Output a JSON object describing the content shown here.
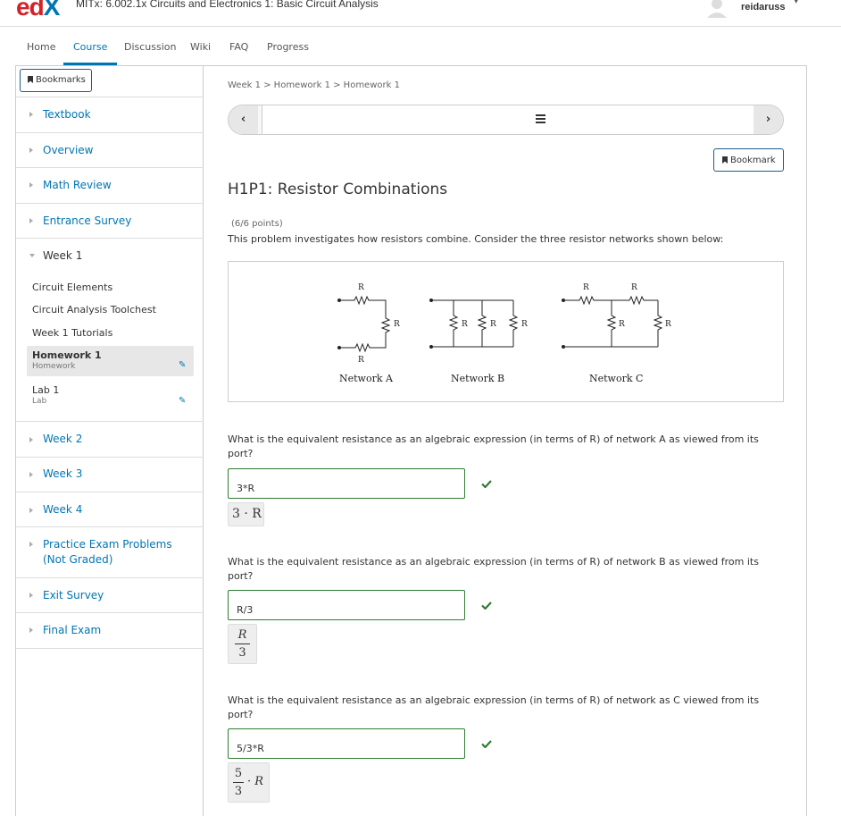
{
  "header": {
    "logo_text": "edX",
    "course_title": "MITx: 6.002.1x Circuits and Electronics 1: Basic Circuit Analysis",
    "username": "reidaruss",
    "avatar_icon": "avatar-icon",
    "caret_icon": "chevron-down-icon"
  },
  "nav": {
    "tabs": [
      {
        "label": "Home",
        "active": false
      },
      {
        "label": "Course",
        "active": true
      },
      {
        "label": "Discussion",
        "active": false
      },
      {
        "label": "Wiki",
        "active": false
      },
      {
        "label": "FAQ",
        "active": false
      },
      {
        "label": "Progress",
        "active": false
      }
    ]
  },
  "sidebar": {
    "bookmarks_label": "Bookmarks",
    "sections": [
      {
        "label": "Textbook"
      },
      {
        "label": "Overview"
      },
      {
        "label": "Math Review"
      },
      {
        "label": "Entrance Survey"
      },
      {
        "label": "Week 1",
        "expanded": true
      }
    ],
    "week1_items": [
      {
        "label": "Circuit Elements"
      },
      {
        "label": "Circuit Analysis Toolchest"
      },
      {
        "label": "Week 1 Tutorials"
      },
      {
        "label": "Homework 1",
        "type": "Homework",
        "active": true
      },
      {
        "label": "Lab 1",
        "type": "Lab"
      }
    ],
    "later_sections": [
      {
        "label": "Week 2"
      },
      {
        "label": "Week 3"
      },
      {
        "label": "Week 4"
      },
      {
        "label": "Practice Exam Problems (Not Graded)"
      },
      {
        "label": "Exit Survey"
      },
      {
        "label": "Final Exam"
      }
    ]
  },
  "main": {
    "breadcrumb": "Week 1 > Homework 1 > Homework 1",
    "seq_prev": "‹",
    "seq_next": "›",
    "bookmark_label": "Bookmark",
    "problem_title": "H1P1: Resistor Combinations",
    "points": "(6/6 points)",
    "intro": "This problem investigates how resistors combine. Consider the three resistor networks shown below:",
    "figure": {
      "networks": [
        "Network A",
        "Network B",
        "Network C"
      ],
      "resistor_label": "R"
    },
    "questions": [
      {
        "text": "What is the equivalent resistance as an algebraic expression (in terms of R) of network A as viewed from its port?",
        "answer": "3*R",
        "preview": "3 · R"
      },
      {
        "text": "What is the equivalent resistance as an algebraic expression (in terms of R) of network B as viewed from its port?",
        "answer": "R/3",
        "preview_num": "R",
        "preview_den": "3"
      },
      {
        "text": "What is the equivalent resistance as an algebraic expression (in terms of R) of network as C viewed from its port?",
        "answer": "5/3*R",
        "preview_num": "5",
        "preview_den": "3",
        "preview_tail": "· R"
      }
    ],
    "status": "correct",
    "colors": {
      "accent": "#0075b4",
      "correct": "#2e7d32"
    }
  }
}
